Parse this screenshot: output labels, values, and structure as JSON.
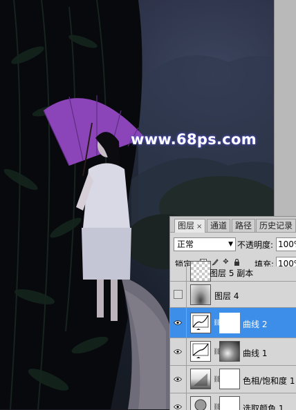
{
  "watermark": "www.68ps.com",
  "panel": {
    "tabs": [
      {
        "label": "图层",
        "close": "×",
        "active": true
      },
      {
        "label": "通道",
        "active": false
      },
      {
        "label": "路径",
        "active": false
      },
      {
        "label": "历史记录",
        "active": false
      }
    ],
    "blend_mode": "正常",
    "opacity_label": "不透明度:",
    "opacity_value": "100%",
    "lock_label": "锁定:",
    "fill_label": "填充:",
    "fill_value": "100%",
    "lock_icons": [
      "lock-transparent-icon",
      "brush-icon",
      "move-icon",
      "lock-icon"
    ],
    "layers": [
      {
        "name": "图层 5 副本",
        "visible": false,
        "type": "pixel-checker",
        "selected": false
      },
      {
        "name": "图层 4",
        "visible": false,
        "type": "pixel-gradient",
        "selected": false
      },
      {
        "name": "曲线 2",
        "visible": true,
        "type": "curves",
        "selected": true
      },
      {
        "name": "曲线 1",
        "visible": true,
        "type": "curves-mask",
        "selected": false
      },
      {
        "name": "色相/饱和度 1",
        "visible": true,
        "type": "hue-sat",
        "selected": false
      },
      {
        "name": "选取颜色 1",
        "visible": true,
        "type": "selective-color",
        "selected": false
      }
    ]
  },
  "colors": {
    "selected_row": "#3d8ee8",
    "umbrella": "#8b45b8",
    "watermark_glow": "#5a5ad0"
  }
}
